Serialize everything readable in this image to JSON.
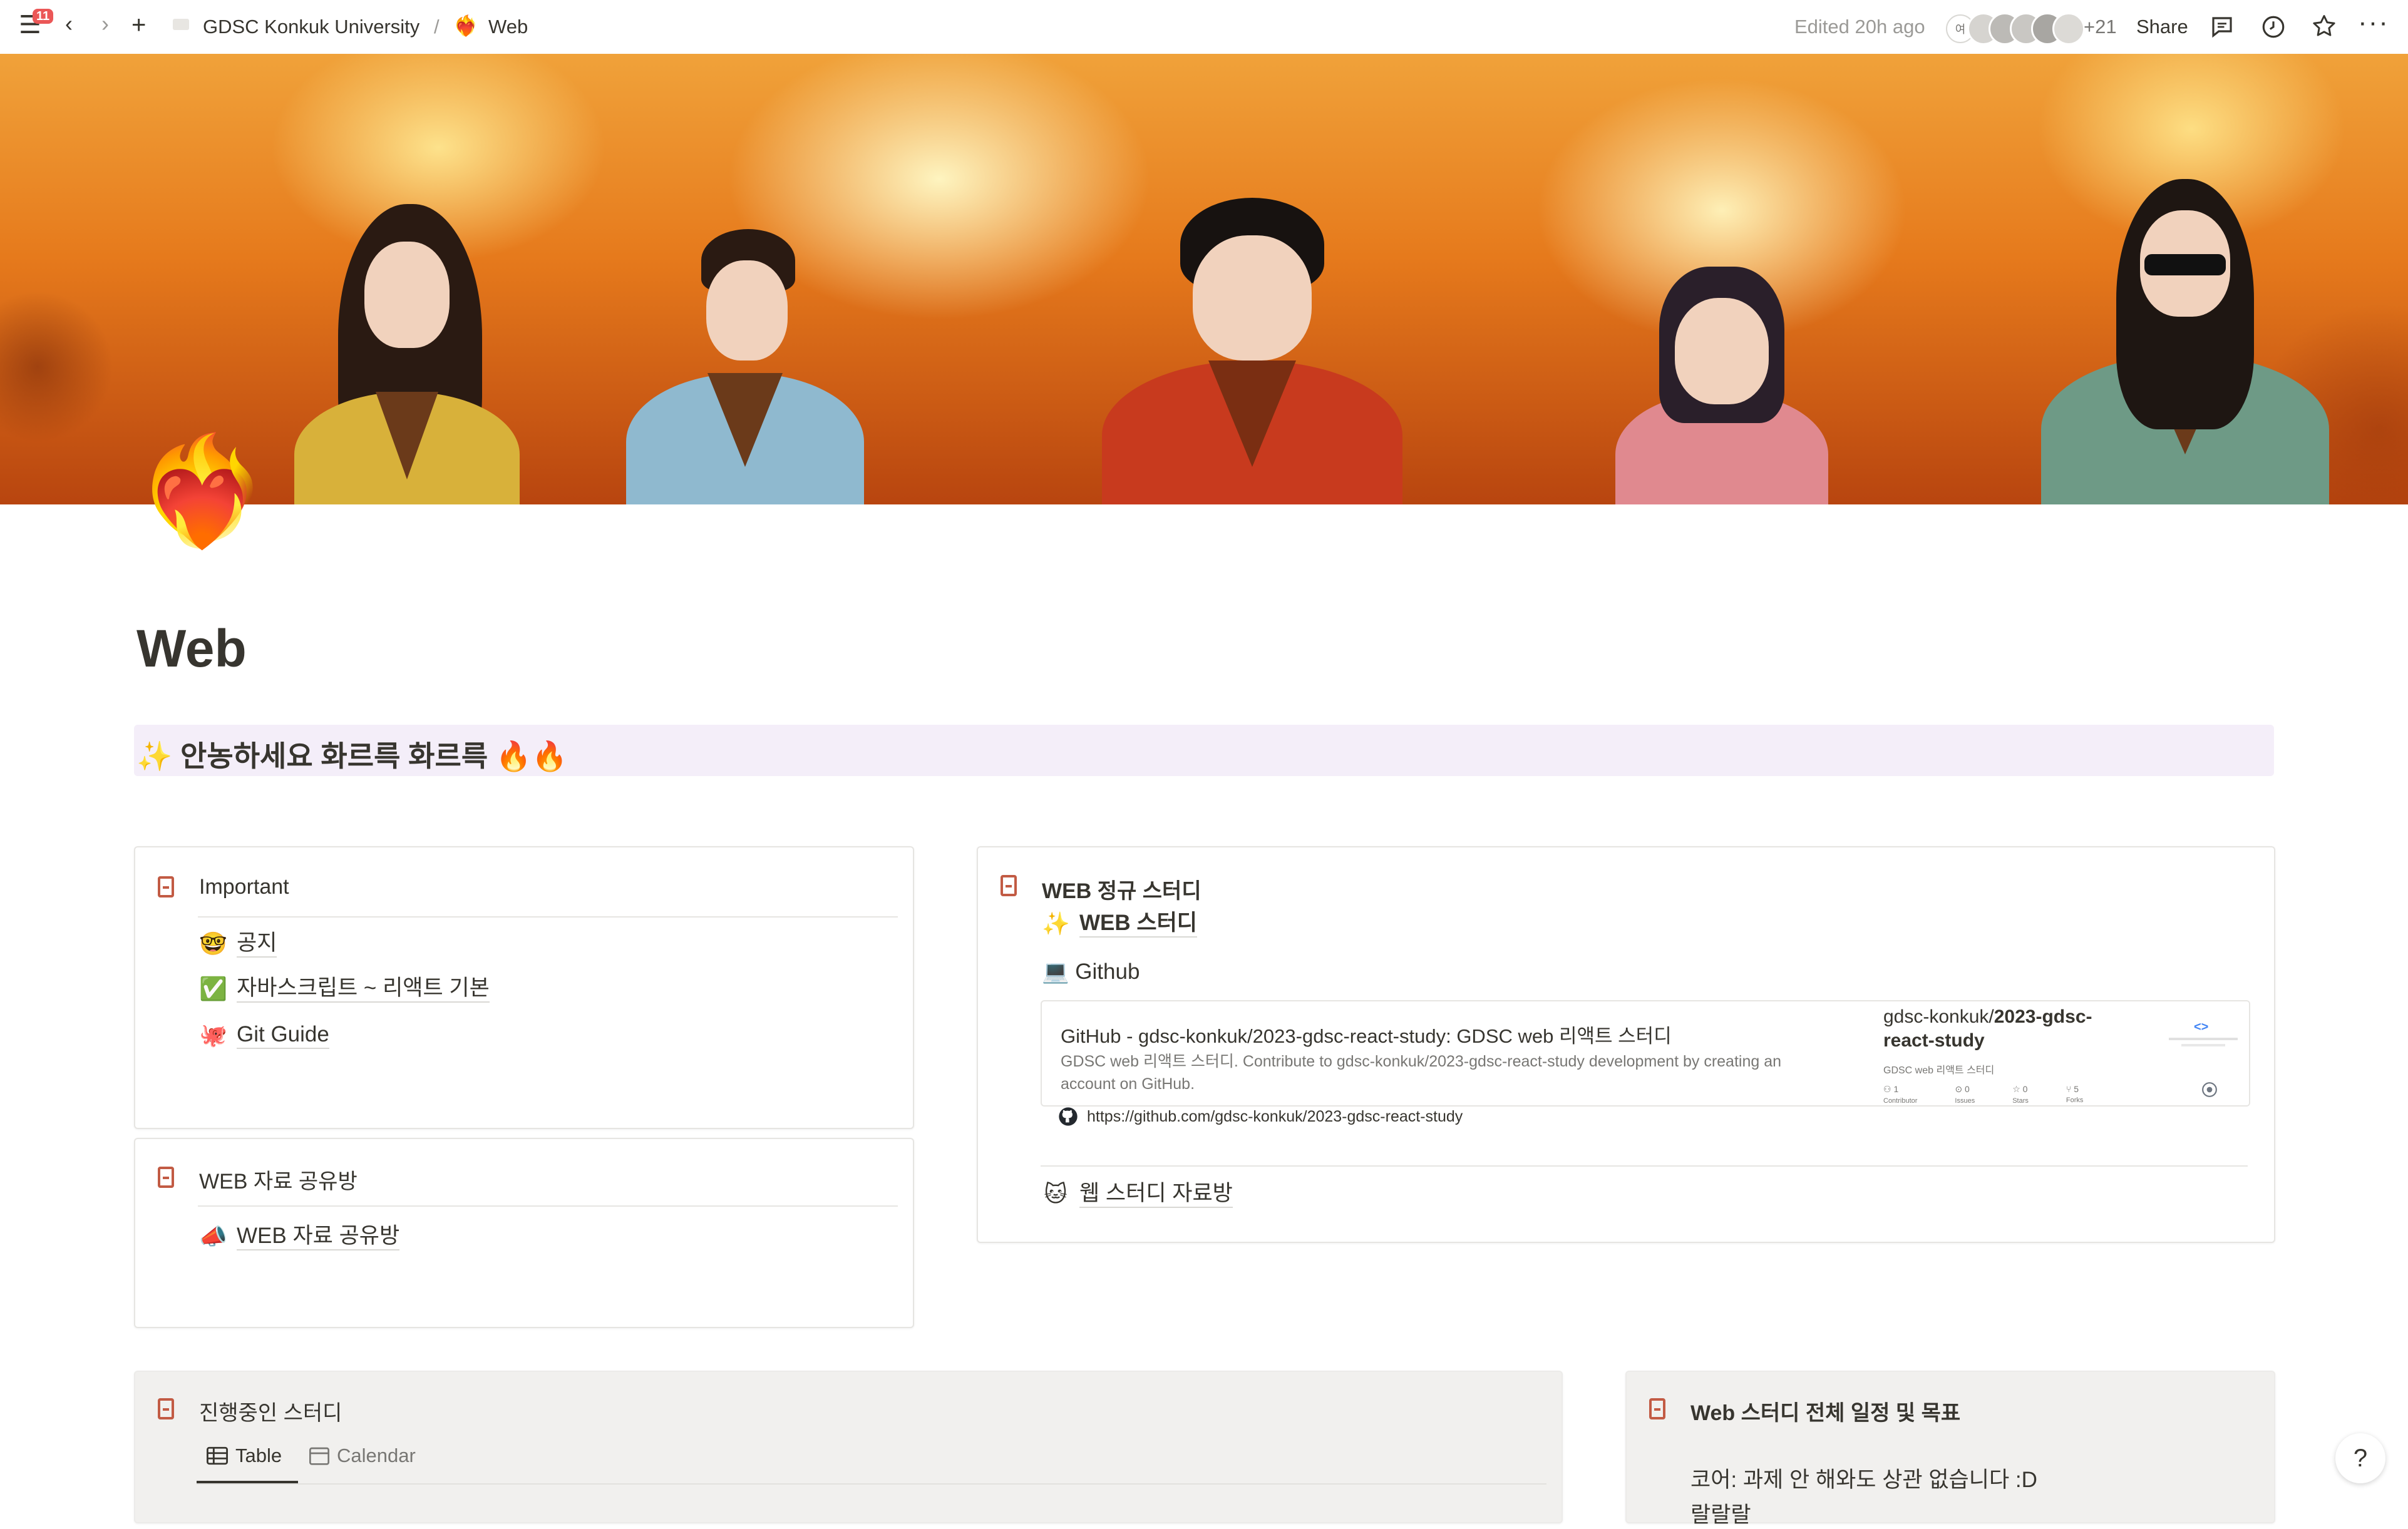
{
  "topbar": {
    "notification_count": "11",
    "workspace": "GDSC Konkuk University",
    "separator": "/",
    "page_emoji": "❤️‍🔥",
    "page_name": "Web",
    "edited": "Edited 20h ago",
    "avatar_initial": "여",
    "collaborators_extra": "+21",
    "share_label": "Share"
  },
  "page": {
    "icon": "❤️‍🔥",
    "title": "Web",
    "callout": "✨ 안농하세요 화르륵 화르륵 🔥🔥"
  },
  "important": {
    "title": "Important",
    "items": [
      {
        "emoji": "🤓",
        "label": "공지"
      },
      {
        "emoji": "✅",
        "label": "자바스크립트 ~ 리액트 기본"
      },
      {
        "emoji": "🐙",
        "label": "Git Guide"
      }
    ]
  },
  "resources": {
    "title": "WEB 자료 공유방",
    "items": [
      {
        "emoji": "📣",
        "label": "WEB 자료 공유방"
      }
    ]
  },
  "regular_study": {
    "title": "WEB 정규 스터디",
    "items": [
      {
        "emoji": "✨",
        "label": "WEB 스터디"
      }
    ],
    "github_label": "💻 Github",
    "bookmark": {
      "title": "GitHub - gdsc-konkuk/2023-gdsc-react-study: GDSC web 리액트 스터디",
      "description": "GDSC web 리액트 스터디. Contribute to gdsc-konkuk/2023-gdsc-react-study development by creating an account on GitHub.",
      "url": "https://github.com/gdsc-konkuk/2023-gdsc-react-study",
      "preview_repo_owner": "gdsc-konkuk/",
      "preview_repo_name": "2023-gdsc-react-study",
      "preview_desc": "GDSC web 리액트 스터디",
      "stats": [
        {
          "icon": "contributor-icon",
          "value": "1",
          "label": "Contributor"
        },
        {
          "icon": "issue-icon",
          "value": "0",
          "label": "Issues"
        },
        {
          "icon": "star-icon",
          "value": "0",
          "label": "Stars"
        },
        {
          "icon": "fork-icon",
          "value": "5",
          "label": "Forks"
        }
      ]
    },
    "extra_item": {
      "emoji": "🐱",
      "label": "웹 스터디 자료방"
    }
  },
  "ongoing": {
    "title": "진행중인 스터디",
    "tabs": [
      {
        "icon": "table-icon",
        "label": "Table",
        "active": true
      },
      {
        "icon": "calendar-icon",
        "label": "Calendar",
        "active": false
      }
    ]
  },
  "schedule": {
    "title": "Web 스터디 전체 일정 및 목표",
    "line1": "코어: 과제 안 해와도 상관 없습니다 :D",
    "line2": "랄랄랄"
  },
  "help_label": "?",
  "colors": {
    "text": "#37352f",
    "muted": "#787774",
    "border": "#e6e5e2",
    "callout_bg": "#f4eef9",
    "grey_card_bg": "#f1f0ee",
    "book_icon": "#c25b44",
    "badge": "#eb5757"
  }
}
